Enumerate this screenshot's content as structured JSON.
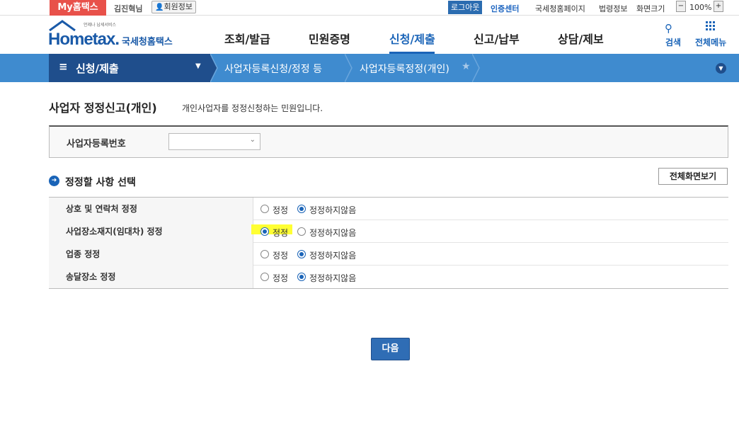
{
  "topbar": {
    "my_tab": "My홈택스",
    "user": "김진혁님",
    "member_info": "회원정보",
    "logout": "로그아웃",
    "cert_center": "인증센터",
    "links": [
      "국세청홈페이지",
      "법령정보",
      "화면크기"
    ],
    "zoom_minus": "−",
    "zoom_value": "100%",
    "zoom_plus": "+"
  },
  "header": {
    "logo_text": "Hometax.",
    "logo_small": "언제나 납세서비스",
    "logo_kr": "국세청홈택스",
    "nav": [
      "조회/발급",
      "민원증명",
      "신청/제출",
      "신고/납부",
      "상담/제보"
    ],
    "search": "검색",
    "all_menu": "전체메뉴"
  },
  "breadcrumb": {
    "main": "신청/제출",
    "hamburger": "≡",
    "level2": "사업자등록신청/정정 등",
    "level3": "사업자등록정정(개인)"
  },
  "page": {
    "title": "사업자 정정신고(개인)",
    "description": "개인사업자를 정정신청하는 민원입니다."
  },
  "biz_number": {
    "label": "사업자등록번호",
    "selected": ""
  },
  "section": {
    "title": "정정할 사항 선택",
    "full_view_button": "전체화면보기"
  },
  "options": [
    {
      "label": "상호 및 연락처 정정",
      "choice_yes": "정정",
      "choice_no": "정정하지않음",
      "selected": "no"
    },
    {
      "label": "사업장소재지(임대차) 정정",
      "choice_yes": "정정",
      "choice_no": "정정하지않음",
      "selected": "yes"
    },
    {
      "label": "업종 정정",
      "choice_yes": "정정",
      "choice_no": "정정하지않음",
      "selected": "no"
    },
    {
      "label": "송달장소 정정",
      "choice_yes": "정정",
      "choice_no": "정정하지않음",
      "selected": "no"
    }
  ],
  "next_button": "다음"
}
